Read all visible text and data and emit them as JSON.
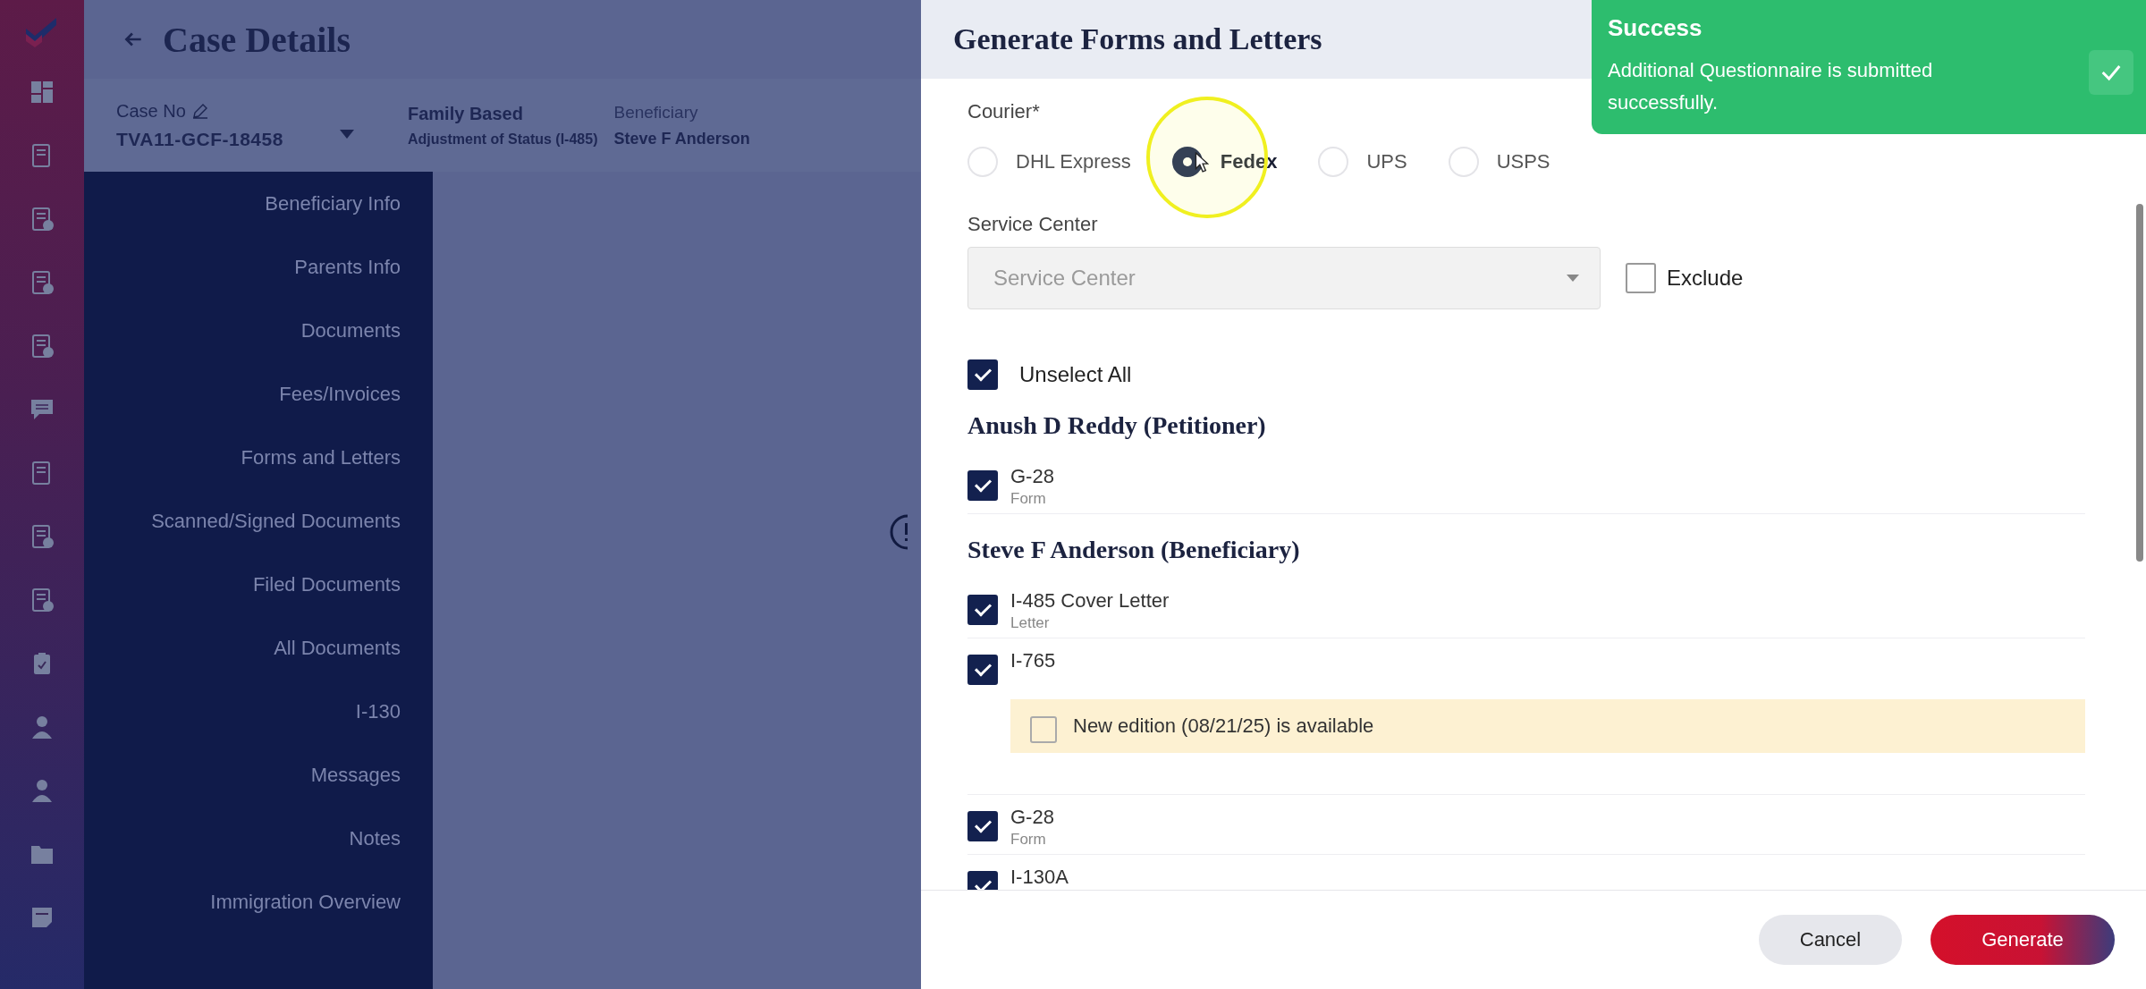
{
  "app": {
    "title": "Case Details"
  },
  "case_bar": {
    "case_no_label": "Case No",
    "case_no": "TVA11-GCF-18458",
    "category": "Family Based",
    "case_type": "Adjustment of Status (I-485)",
    "beneficiary_label": "Beneficiary",
    "beneficiary": "Steve F Anderson"
  },
  "sidebar": {
    "items": [
      "Beneficiary Info",
      "Parents Info",
      "Documents",
      "Fees/Invoices",
      "Forms and Letters",
      "Scanned/Signed Documents",
      "Filed Documents",
      "All Documents",
      "I-130",
      "Messages",
      "Notes",
      "Immigration Overview"
    ]
  },
  "drawer": {
    "title": "Generate Forms and Letters",
    "courier": {
      "label": "Courier*",
      "options": [
        {
          "label": "DHL Express",
          "selected": false
        },
        {
          "label": "Fedex",
          "selected": true
        },
        {
          "label": "UPS",
          "selected": false
        },
        {
          "label": "USPS",
          "selected": false
        }
      ]
    },
    "service_center": {
      "label": "Service Center",
      "placeholder": "Service Center"
    },
    "exclude": {
      "label": "Exclude",
      "checked": false
    },
    "select_all": {
      "label": "Unselect All",
      "checked": true
    },
    "groups": [
      {
        "title": "Anush D Reddy (Petitioner)",
        "items": [
          {
            "name": "G-28",
            "type": "Form",
            "checked": true
          }
        ]
      },
      {
        "title": "Steve F Anderson (Beneficiary)",
        "items": [
          {
            "name": "I-485 Cover Letter",
            "type": "Letter",
            "checked": true
          },
          {
            "name": "I-765",
            "checked": true,
            "notice": {
              "text": "New edition (08/21/25) is available",
              "checked": false
            }
          },
          {
            "name": "G-28",
            "type": "Form",
            "checked": true
          },
          {
            "name": "I-130A",
            "checked": true
          }
        ]
      }
    ],
    "buttons": [
      {
        "label": "Cancel",
        "kind": "secondary"
      },
      {
        "label": "Generate",
        "kind": "primary"
      }
    ]
  },
  "toast": {
    "title": "Success",
    "message": "Additional Questionnaire is submitted successfully."
  }
}
